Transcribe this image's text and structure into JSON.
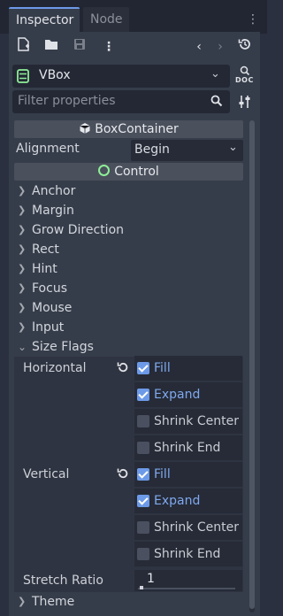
{
  "tabs": [
    {
      "label": "Inspector",
      "active": true
    },
    {
      "label": "Node",
      "active": false
    }
  ],
  "toolbar": {
    "new_icon": "new-resource-icon",
    "open_icon": "folder-icon",
    "save_icon": "save-icon",
    "more_icon": "kebab-menu-icon",
    "back_icon": "chevron-left-icon",
    "forward_icon": "chevron-right-icon",
    "history_icon": "history-icon"
  },
  "node_select": {
    "value": "VBox",
    "doc_label": "DOC"
  },
  "filter": {
    "placeholder": "Filter properties"
  },
  "sections": {
    "box_container": "BoxContainer",
    "control": "Control"
  },
  "alignment": {
    "label": "Alignment",
    "value": "Begin"
  },
  "groups": [
    "Anchor",
    "Margin",
    "Grow Direction",
    "Rect",
    "Hint",
    "Focus",
    "Mouse",
    "Input"
  ],
  "size_flags": {
    "label": "Size Flags",
    "horizontal": {
      "label": "Horizontal",
      "options": [
        {
          "label": "Fill",
          "checked": true
        },
        {
          "label": "Expand",
          "checked": true
        },
        {
          "label": "Shrink Center",
          "checked": false
        },
        {
          "label": "Shrink End",
          "checked": false
        }
      ]
    },
    "vertical": {
      "label": "Vertical",
      "options": [
        {
          "label": "Fill",
          "checked": true
        },
        {
          "label": "Expand",
          "checked": true
        },
        {
          "label": "Shrink Center",
          "checked": false
        },
        {
          "label": "Shrink End",
          "checked": false
        }
      ]
    },
    "stretch_ratio": {
      "label": "Stretch Ratio",
      "value": "1"
    }
  },
  "theme_label": "Theme",
  "colors": {
    "accent": "#6d9ae8",
    "background": "#2b3040",
    "panel": "#363d4a"
  }
}
